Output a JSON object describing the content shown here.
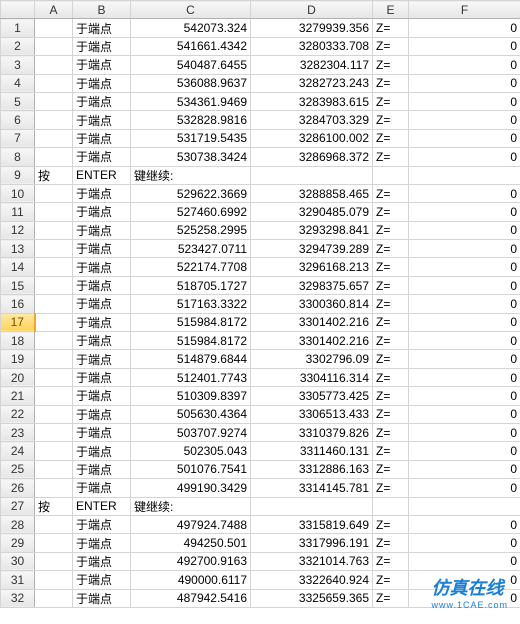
{
  "columns": [
    "A",
    "B",
    "C",
    "D",
    "E",
    "F"
  ],
  "selectedRow": 17,
  "watermark": {
    "main": "仿真在线",
    "sub": "www.1CAE.com"
  },
  "faintWatermark": "",
  "rows": [
    {
      "n": 1,
      "A": "",
      "B": "于端点",
      "C": "542073.324",
      "D": "3279939.356",
      "E": "Z=",
      "F": "0"
    },
    {
      "n": 2,
      "A": "",
      "B": "于端点",
      "C": "541661.4342",
      "D": "3280333.708",
      "E": "Z=",
      "F": "0"
    },
    {
      "n": 3,
      "A": "",
      "B": "于端点",
      "C": "540487.6455",
      "D": "3282304.117",
      "E": "Z=",
      "F": "0"
    },
    {
      "n": 4,
      "A": "",
      "B": "于端点",
      "C": "536088.9637",
      "D": "3282723.243",
      "E": "Z=",
      "F": "0"
    },
    {
      "n": 5,
      "A": "",
      "B": "于端点",
      "C": "534361.9469",
      "D": "3283983.615",
      "E": "Z=",
      "F": "0"
    },
    {
      "n": 6,
      "A": "",
      "B": "于端点",
      "C": "532828.9816",
      "D": "3284703.329",
      "E": "Z=",
      "F": "0"
    },
    {
      "n": 7,
      "A": "",
      "B": "于端点",
      "C": "531719.5435",
      "D": "3286100.002",
      "E": "Z=",
      "F": "0"
    },
    {
      "n": 8,
      "A": "",
      "B": "于端点",
      "C": "530738.3424",
      "D": "3286968.372",
      "E": "Z=",
      "F": "0"
    },
    {
      "n": 9,
      "A": "按",
      "B": "ENTER",
      "C": "键继续:",
      "D": "",
      "E": "",
      "F": ""
    },
    {
      "n": 10,
      "A": "",
      "B": "于端点",
      "C": "529622.3669",
      "D": "3288858.465",
      "E": "Z=",
      "F": "0"
    },
    {
      "n": 11,
      "A": "",
      "B": "于端点",
      "C": "527460.6992",
      "D": "3290485.079",
      "E": "Z=",
      "F": "0"
    },
    {
      "n": 12,
      "A": "",
      "B": "于端点",
      "C": "525258.2995",
      "D": "3293298.841",
      "E": "Z=",
      "F": "0"
    },
    {
      "n": 13,
      "A": "",
      "B": "于端点",
      "C": "523427.0711",
      "D": "3294739.289",
      "E": "Z=",
      "F": "0"
    },
    {
      "n": 14,
      "A": "",
      "B": "于端点",
      "C": "522174.7708",
      "D": "3296168.213",
      "E": "Z=",
      "F": "0"
    },
    {
      "n": 15,
      "A": "",
      "B": "于端点",
      "C": "518705.1727",
      "D": "3298375.657",
      "E": "Z=",
      "F": "0"
    },
    {
      "n": 16,
      "A": "",
      "B": "于端点",
      "C": "517163.3322",
      "D": "3300360.814",
      "E": "Z=",
      "F": "0"
    },
    {
      "n": 17,
      "A": "",
      "B": "于端点",
      "C": "515984.8172",
      "D": "3301402.216",
      "E": "Z=",
      "F": "0"
    },
    {
      "n": 18,
      "A": "",
      "B": "于端点",
      "C": "515984.8172",
      "D": "3301402.216",
      "E": "Z=",
      "F": "0"
    },
    {
      "n": 19,
      "A": "",
      "B": "于端点",
      "C": "514879.6844",
      "D": "3302796.09",
      "E": "Z=",
      "F": "0"
    },
    {
      "n": 20,
      "A": "",
      "B": "于端点",
      "C": "512401.7743",
      "D": "3304116.314",
      "E": "Z=",
      "F": "0"
    },
    {
      "n": 21,
      "A": "",
      "B": "于端点",
      "C": "510309.8397",
      "D": "3305773.425",
      "E": "Z=",
      "F": "0"
    },
    {
      "n": 22,
      "A": "",
      "B": "于端点",
      "C": "505630.4364",
      "D": "3306513.433",
      "E": "Z=",
      "F": "0"
    },
    {
      "n": 23,
      "A": "",
      "B": "于端点",
      "C": "503707.9274",
      "D": "3310379.826",
      "E": "Z=",
      "F": "0"
    },
    {
      "n": 24,
      "A": "",
      "B": "于端点",
      "C": "502305.043",
      "D": "3311460.131",
      "E": "Z=",
      "F": "0"
    },
    {
      "n": 25,
      "A": "",
      "B": "于端点",
      "C": "501076.7541",
      "D": "3312886.163",
      "E": "Z=",
      "F": "0"
    },
    {
      "n": 26,
      "A": "",
      "B": "于端点",
      "C": "499190.3429",
      "D": "3314145.781",
      "E": "Z=",
      "F": "0"
    },
    {
      "n": 27,
      "A": "按",
      "B": "ENTER",
      "C": "键继续:",
      "D": "",
      "E": "",
      "F": ""
    },
    {
      "n": 28,
      "A": "",
      "B": "于端点",
      "C": "497924.7488",
      "D": "3315819.649",
      "E": "Z=",
      "F": "0"
    },
    {
      "n": 29,
      "A": "",
      "B": "于端点",
      "C": "494250.501",
      "D": "3317996.191",
      "E": "Z=",
      "F": "0"
    },
    {
      "n": 30,
      "A": "",
      "B": "于端点",
      "C": "492700.9163",
      "D": "3321014.763",
      "E": "Z=",
      "F": "0"
    },
    {
      "n": 31,
      "A": "",
      "B": "于端点",
      "C": "490000.6117",
      "D": "3322640.924",
      "E": "Z=",
      "F": "0"
    },
    {
      "n": 32,
      "A": "",
      "B": "于端点",
      "C": "487942.5416",
      "D": "3325659.365",
      "E": "Z=",
      "F": "0"
    }
  ]
}
